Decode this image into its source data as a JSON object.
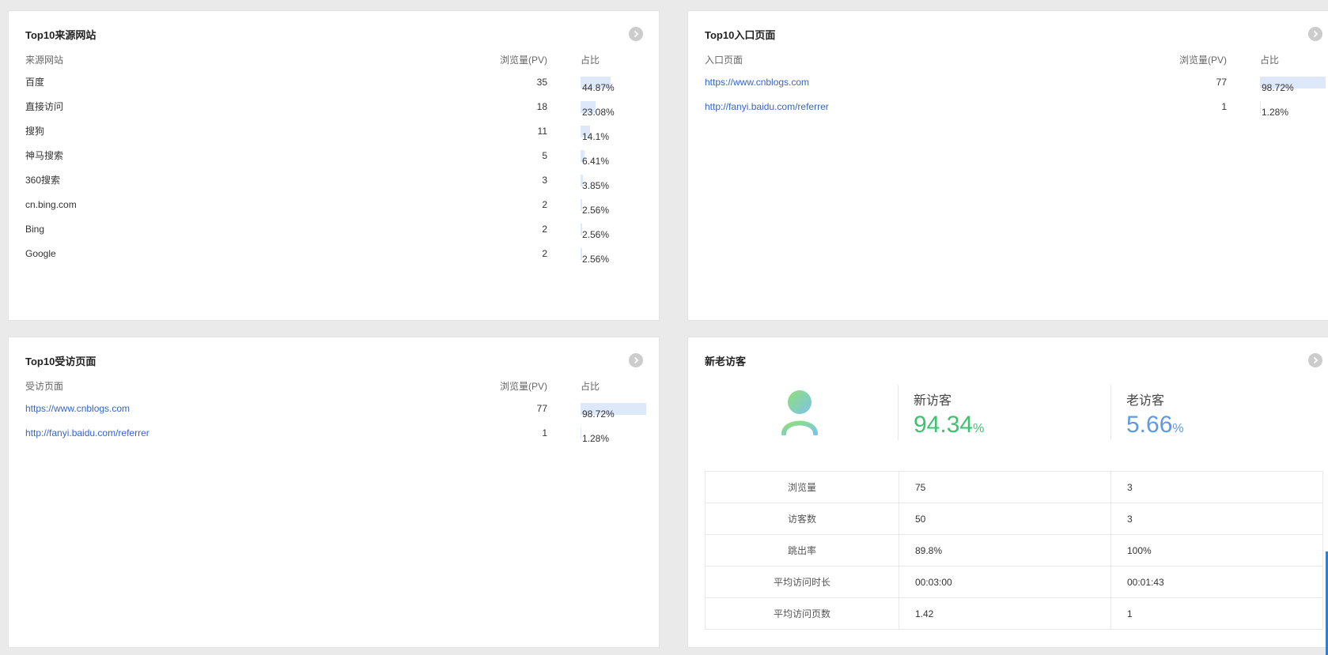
{
  "source_panel": {
    "title": "Top10来源网站",
    "headers": {
      "name": "来源网站",
      "pv": "浏览量(PV)",
      "ratio": "占比"
    },
    "rows": [
      {
        "name": "百度",
        "pv": "35",
        "ratio": "44.87%",
        "ratio_value": 44.87
      },
      {
        "name": "直接访问",
        "pv": "18",
        "ratio": "23.08%",
        "ratio_value": 23.08
      },
      {
        "name": "搜狗",
        "pv": "11",
        "ratio": "14.1%",
        "ratio_value": 14.1
      },
      {
        "name": "神马搜索",
        "pv": "5",
        "ratio": "6.41%",
        "ratio_value": 6.41
      },
      {
        "name": "360搜索",
        "pv": "3",
        "ratio": "3.85%",
        "ratio_value": 3.85
      },
      {
        "name": "cn.bing.com",
        "pv": "2",
        "ratio": "2.56%",
        "ratio_value": 2.56
      },
      {
        "name": "Bing",
        "pv": "2",
        "ratio": "2.56%",
        "ratio_value": 2.56
      },
      {
        "name": "Google",
        "pv": "2",
        "ratio": "2.56%",
        "ratio_value": 2.56
      }
    ]
  },
  "entry_panel": {
    "title": "Top10入口页面",
    "headers": {
      "name": "入口页面",
      "pv": "浏览量(PV)",
      "ratio": "占比"
    },
    "rows": [
      {
        "name": "https://www.cnblogs.com",
        "pv": "77",
        "ratio": "98.72%",
        "ratio_value": 98.72
      },
      {
        "name": "http://fanyi.baidu.com/referrer",
        "pv": "1",
        "ratio": "1.28%",
        "ratio_value": 1.28
      }
    ]
  },
  "visited_panel": {
    "title": "Top10受访页面",
    "headers": {
      "name": "受访页面",
      "pv": "浏览量(PV)",
      "ratio": "占比"
    },
    "rows": [
      {
        "name": "https://www.cnblogs.com",
        "pv": "77",
        "ratio": "98.72%",
        "ratio_value": 98.72
      },
      {
        "name": "http://fanyi.baidu.com/referrer",
        "pv": "1",
        "ratio": "1.28%",
        "ratio_value": 1.28
      }
    ]
  },
  "visitor_panel": {
    "title": "新老访客",
    "new_label": "新访客",
    "new_value": "94.34",
    "old_label": "老访客",
    "old_value": "5.66",
    "pct_sign": "%",
    "colors": {
      "new": "#3dc26f",
      "old": "#5b9be6",
      "bar": "#dde9fa"
    },
    "table": [
      {
        "label": "浏览量",
        "new": "75",
        "old": "3"
      },
      {
        "label": "访客数",
        "new": "50",
        "old": "3"
      },
      {
        "label": "跳出率",
        "new": "89.8%",
        "old": "100%"
      },
      {
        "label": "平均访问时长",
        "new": "00:03:00",
        "old": "00:01:43"
      },
      {
        "label": "平均访问页数",
        "new": "1.42",
        "old": "1"
      }
    ]
  },
  "icons": {
    "more": "chevron-right-circle-icon",
    "avatar": "user-avatar-icon"
  }
}
